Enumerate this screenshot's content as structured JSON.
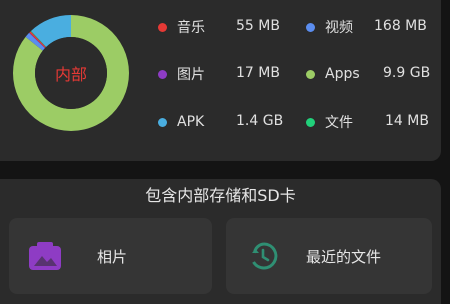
{
  "storage": {
    "center_label": "内部",
    "segments": [
      {
        "name": "APK",
        "value": 1.4,
        "color": "#4aaee0"
      },
      {
        "name": "Apps",
        "value": 9.9,
        "color": "#9ccc65"
      },
      {
        "name": "视频",
        "value": 0.168,
        "color": "#5b8def"
      },
      {
        "name": "图片",
        "value": 0.017,
        "color": "#8e3cc4"
      },
      {
        "name": "音乐",
        "value": 0.055,
        "color": "#e53935"
      },
      {
        "name": "文件",
        "value": 0.014,
        "color": "#21d07a"
      }
    ],
    "legend": [
      {
        "name": "音乐",
        "size": "55 MB",
        "color": "#e53935"
      },
      {
        "name": "视频",
        "size": "168 MB",
        "color": "#5b8def"
      },
      {
        "name": "图片",
        "size": "17 MB",
        "color": "#8e3cc4"
      },
      {
        "name": "Apps",
        "size": "9.9 GB",
        "color": "#9ccc65"
      },
      {
        "name": "APK",
        "size": "1.4 GB",
        "color": "#4aaee0"
      },
      {
        "name": "文件",
        "size": "14 MB",
        "color": "#21d07a"
      }
    ]
  },
  "section": {
    "title": "包含内部存储和SD卡"
  },
  "tiles": {
    "photos": {
      "label": "相片",
      "icon": "photo-icon",
      "color": "#8e3cc4"
    },
    "recent": {
      "label": "最近的文件",
      "icon": "history-icon",
      "color": "#2f8f73"
    }
  }
}
